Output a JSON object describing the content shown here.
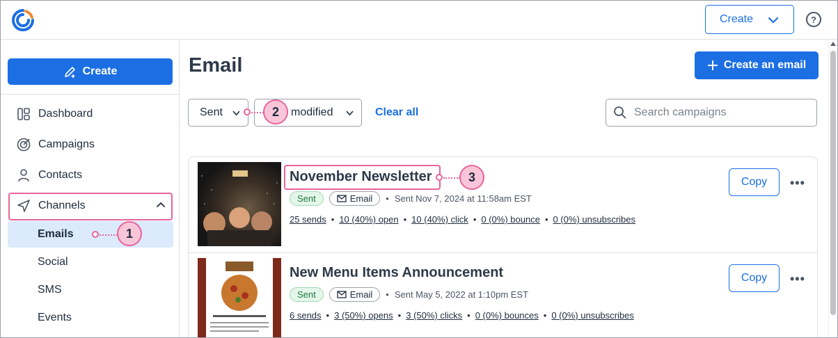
{
  "app": {
    "brand_colors": {
      "primary": "#1b6fe3",
      "accent": "#f28b2d",
      "highlight": "#e8649a"
    }
  },
  "header": {
    "create_label": "Create",
    "help_icon": "question-circle-icon"
  },
  "sidebar": {
    "create_label": "Create",
    "items": [
      {
        "label": "Dashboard",
        "icon": "dashboard-icon"
      },
      {
        "label": "Campaigns",
        "icon": "target-icon"
      },
      {
        "label": "Contacts",
        "icon": "person-icon"
      },
      {
        "label": "Channels",
        "icon": "send-icon"
      }
    ],
    "channels_sub": [
      {
        "label": "Emails",
        "active": true
      },
      {
        "label": "Social"
      },
      {
        "label": "SMS"
      },
      {
        "label": "Events"
      }
    ]
  },
  "main": {
    "title": "Email",
    "create_email_label": "Create an email",
    "filters": {
      "status_label": "Sent",
      "sort_label": "modified",
      "clear_all": "Clear all",
      "search_placeholder": "Search campaigns"
    },
    "campaigns": [
      {
        "name": "November Newsletter",
        "status": "Sent",
        "type": "Email",
        "sent_info": "Sent Nov 7, 2024 at 11:58am EST",
        "stats": [
          "25 sends",
          "10 (40%) open",
          "10 (40%) click",
          "0 (0%) bounce",
          "0 (0%) unsubscribes"
        ],
        "copy_label": "Copy"
      },
      {
        "name": "New Menu Items Announcement",
        "status": "Sent",
        "type": "Email",
        "sent_info": "Sent May 5, 2022 at 1:10pm EST",
        "stats": [
          "6 sends",
          "3 (50%) opens",
          "3 (50%) clicks",
          "0 (0%) bounces",
          "0 (0%) unsubscribes"
        ],
        "copy_label": "Copy"
      }
    ]
  },
  "callouts": [
    "1",
    "2",
    "3"
  ]
}
